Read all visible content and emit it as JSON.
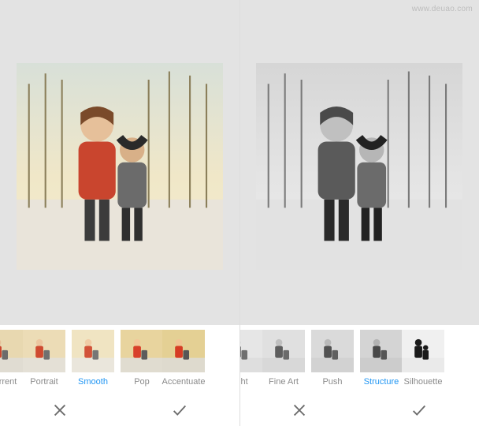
{
  "watermark": "www.deuao.com",
  "left_panel": {
    "filters": [
      {
        "label": "Current",
        "selected": false,
        "style": "color"
      },
      {
        "label": "Portrait",
        "selected": false,
        "style": "color"
      },
      {
        "label": "Smooth",
        "selected": true,
        "style": "color"
      },
      {
        "label": "Pop",
        "selected": false,
        "style": "color"
      },
      {
        "label": "Accentuate",
        "selected": false,
        "style": "color"
      }
    ],
    "actions": {
      "cancel": "✕",
      "apply": "✓"
    }
  },
  "right_panel": {
    "filters": [
      {
        "label": "ght",
        "selected": false,
        "style": "bw"
      },
      {
        "label": "Fine Art",
        "selected": false,
        "style": "bw"
      },
      {
        "label": "Push",
        "selected": false,
        "style": "bw"
      },
      {
        "label": "Structure",
        "selected": true,
        "style": "bw"
      },
      {
        "label": "Silhouette",
        "selected": false,
        "style": "bw-dark"
      }
    ],
    "actions": {
      "cancel": "✕",
      "apply": "✓"
    }
  }
}
